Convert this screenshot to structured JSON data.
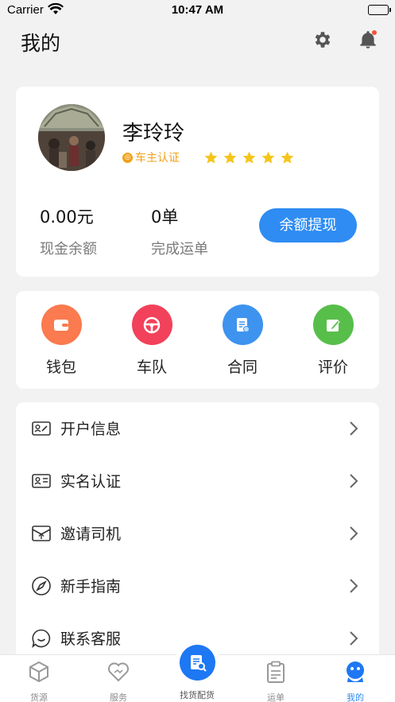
{
  "status_bar": {
    "carrier": "Carrier",
    "time": "10:47 AM"
  },
  "header": {
    "title": "我的"
  },
  "profile": {
    "name": "李玲玲",
    "badge": "车主认证",
    "rating_stars": 5,
    "balance": {
      "value": "0.00元",
      "label": "现金余额"
    },
    "orders": {
      "value": "0单",
      "label": "完成运单"
    },
    "withdraw_button": "余额提现"
  },
  "quick_actions": [
    {
      "label": "钱包",
      "icon": "wallet-icon",
      "color": "#fb7a4f"
    },
    {
      "label": "车队",
      "icon": "steering-wheel-icon",
      "color": "#f2415a"
    },
    {
      "label": "合同",
      "icon": "contract-icon",
      "color": "#3e93ef"
    },
    {
      "label": "评价",
      "icon": "edit-icon",
      "color": "#58be4a"
    }
  ],
  "menu": [
    {
      "label": "开户信息",
      "icon": "account-info-icon"
    },
    {
      "label": "实名认证",
      "icon": "id-card-icon"
    },
    {
      "label": "邀请司机",
      "icon": "invite-icon"
    },
    {
      "label": "新手指南",
      "icon": "compass-icon"
    },
    {
      "label": "联系客服",
      "icon": "chat-icon"
    }
  ],
  "tabbar": {
    "items": [
      {
        "label": "货源",
        "icon": "cube-icon"
      },
      {
        "label": "服务",
        "icon": "heart-icon"
      },
      {
        "label": "找货配货",
        "icon": "search-document-icon"
      },
      {
        "label": "运单",
        "icon": "clipboard-icon"
      },
      {
        "label": "我的",
        "icon": "profile-icon"
      }
    ],
    "active_index": 4,
    "active_color": "#2f8cf2"
  }
}
